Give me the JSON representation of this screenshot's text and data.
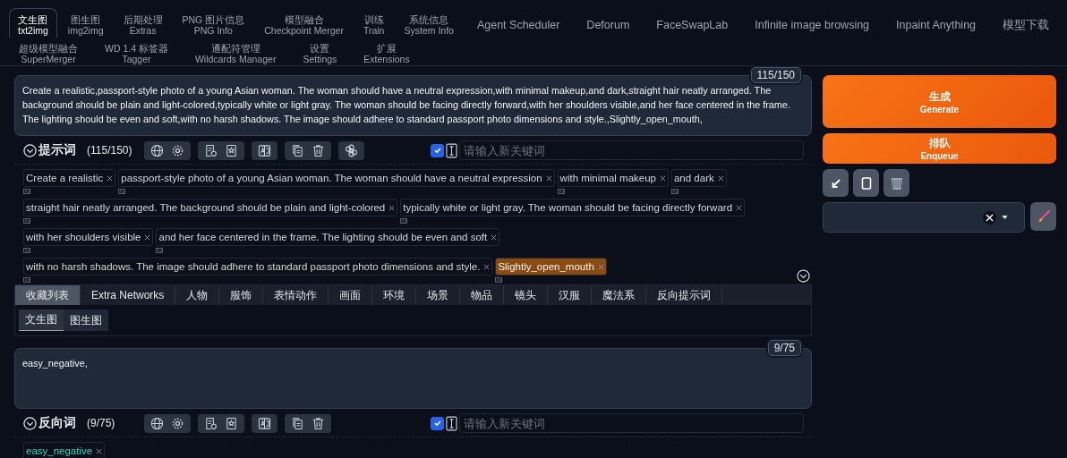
{
  "tabs_row1": [
    {
      "label": "文生图",
      "sublabel": "txt2img",
      "selected": true
    },
    {
      "label": "图生图",
      "sublabel": "img2img",
      "selected": false
    },
    {
      "label": "后期处理",
      "sublabel": "Extras",
      "selected": false
    },
    {
      "label": "PNG 图片信息",
      "sublabel": "PNG Info",
      "selected": false
    },
    {
      "label": "模型融合",
      "sublabel": "Checkpoint Merger",
      "selected": false
    },
    {
      "label": "训练",
      "sublabel": "Train",
      "selected": false
    },
    {
      "label": "系统信息",
      "sublabel": "System Info",
      "selected": false
    },
    {
      "label": "Agent Scheduler",
      "selected": false
    },
    {
      "label": "Deforum",
      "selected": false
    },
    {
      "label": "FaceSwapLab",
      "selected": false
    },
    {
      "label": "Infinite image browsing",
      "selected": false
    },
    {
      "label": "Inpaint Anything",
      "selected": false
    },
    {
      "label": "模型下载",
      "selected": false
    }
  ],
  "tabs_row2": [
    {
      "label": "超级模型融合",
      "sublabel": "SuperMerger",
      "selected": false
    },
    {
      "label": "WD 1.4 标签器",
      "sublabel": "Tagger",
      "selected": false
    },
    {
      "label": "通配符管理",
      "sublabel": "Wildcards Manager",
      "selected": false
    },
    {
      "label": "设置",
      "sublabel": "Settings",
      "selected": false
    },
    {
      "label": "扩展",
      "sublabel": "Extensions",
      "selected": false
    }
  ],
  "prompt": {
    "counter": "115/150",
    "text": "Create a realistic,passport-style photo of a young Asian woman. The woman should have a neutral expression,with minimal makeup,and dark,straight hair neatly arranged. The background should be plain and light-colored,typically white or light gray. The woman should be facing directly forward,with her shoulders visible,and her face centered in the frame. The lighting should be even and soft,with no harsh shadows. The image should adhere to standard passport photo dimensions and style.,Slightly_open_mouth,",
    "kind": "positive",
    "title": "提示词",
    "count": "(115/150)",
    "checked": true,
    "placeholder": "请输入新关键词",
    "tag_rows": [
      {
        "tags": [
          {
            "text": "Create a realistic",
            "kind": "plain"
          },
          {
            "text": "passport-style photo of a young Asian woman. The woman should have a neutral expression",
            "kind": "plain"
          },
          {
            "text": "with minimal makeup",
            "kind": "plain"
          },
          {
            "text": "and dark",
            "kind": "plain"
          }
        ]
      },
      {
        "tags": [
          {
            "text": "straight hair neatly arranged. The background should be plain and light-colored",
            "kind": "plain"
          },
          {
            "text": "typically white or light gray. The woman should be facing directly forward",
            "kind": "plain"
          }
        ]
      },
      {
        "tags": [
          {
            "text": "with her shoulders visible",
            "kind": "plain"
          },
          {
            "text": "and her face centered in the frame. The lighting should be even and soft",
            "kind": "plain"
          }
        ]
      },
      {
        "tags": [
          {
            "text": "with no harsh shadows. The image should adhere to standard passport photo dimensions and style.",
            "kind": "plain"
          },
          {
            "text": "Slightly_open_mouth",
            "kind": "highlight"
          }
        ]
      }
    ]
  },
  "category_tabs": [
    {
      "label": "收藏列表",
      "selected": true
    },
    {
      "label": "Extra Networks",
      "selected": false
    },
    {
      "label": "人物",
      "selected": false
    },
    {
      "label": "服饰",
      "selected": false
    },
    {
      "label": "表情动作",
      "selected": false
    },
    {
      "label": "画面",
      "selected": false
    },
    {
      "label": "环境",
      "selected": false
    },
    {
      "label": "场景",
      "selected": false
    },
    {
      "label": "物品",
      "selected": false
    },
    {
      "label": "镜头",
      "selected": false
    },
    {
      "label": "汉服",
      "selected": false
    },
    {
      "label": "魔法系",
      "selected": false
    },
    {
      "label": "反向提示词",
      "selected": false
    }
  ],
  "sub_tabs": [
    {
      "label": "文生图",
      "selected": true
    },
    {
      "label": "图生图",
      "selected": false
    }
  ],
  "negative": {
    "counter": "9/75",
    "text": "easy_negative,",
    "kind": "negative",
    "title": "反向词",
    "count": "(9/75)",
    "checked": true,
    "placeholder": "请输入新关键词",
    "tag_rows": [
      {
        "tags": [
          {
            "text": "easy_negative",
            "kind": "negative"
          }
        ]
      }
    ]
  },
  "generate": {
    "label": "生成",
    "sublabel": "Generate"
  },
  "enqueue": {
    "label": "排队",
    "sublabel": "Enqueue"
  }
}
